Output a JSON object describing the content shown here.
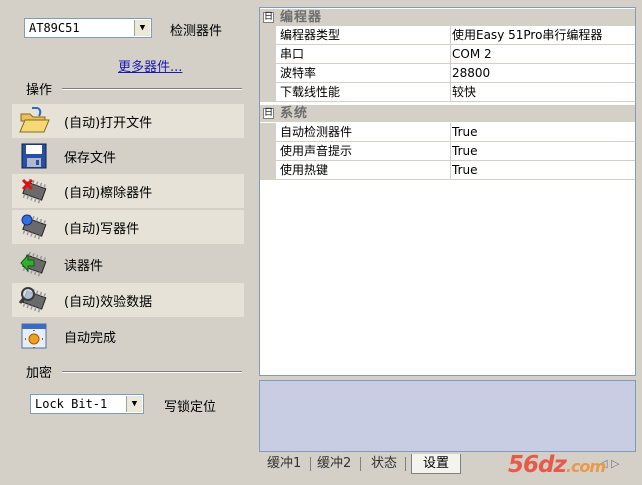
{
  "device_selector": {
    "value": "AT89C51",
    "label": "检测器件",
    "more_link": "更多器件..."
  },
  "actions_section": {
    "title": "操作"
  },
  "actions": [
    {
      "label": "(自动)打开文件",
      "icon": "folder-open-icon"
    },
    {
      "label": "保存文件",
      "icon": "floppy-disk-icon"
    },
    {
      "label": "(自动)檫除器件",
      "icon": "erase-chip-icon"
    },
    {
      "label": "(自动)写器件",
      "icon": "write-chip-icon"
    },
    {
      "label": "读器件",
      "icon": "read-chip-icon"
    },
    {
      "label": "(自动)效验数据",
      "icon": "verify-chip-icon"
    },
    {
      "label": "自动完成",
      "icon": "auto-complete-icon"
    }
  ],
  "encrypt_section": {
    "title": "加密",
    "lock_value": "Lock Bit-1",
    "lock_label": "写锁定位"
  },
  "property_grid": {
    "categories": [
      {
        "title": "编程器",
        "rows": [
          {
            "key": "编程器类型",
            "value": "使用Easy 51Pro串行编程器"
          },
          {
            "key": "串口",
            "value": "COM 2"
          },
          {
            "key": "波特率",
            "value": "28800"
          },
          {
            "key": "下载线性能",
            "value": "较快"
          }
        ]
      },
      {
        "title": "系统",
        "rows": [
          {
            "key": "自动检测器件",
            "value": "True"
          },
          {
            "key": "使用声音提示",
            "value": "True"
          },
          {
            "key": "使用热键",
            "value": "True"
          }
        ]
      }
    ],
    "collapse_glyph": "日"
  },
  "tabs": [
    {
      "label": "缓冲1"
    },
    {
      "label": "缓冲2"
    },
    {
      "label": "状态"
    },
    {
      "label": "设置",
      "selected": true
    }
  ],
  "watermark": {
    "text": "56dz",
    "tld": ".com"
  },
  "colors": {
    "panel_bg": "#d4d0c8",
    "desc_bg": "#c8cde3",
    "link": "#1a1ab3",
    "watermark": "#e55a4a"
  }
}
